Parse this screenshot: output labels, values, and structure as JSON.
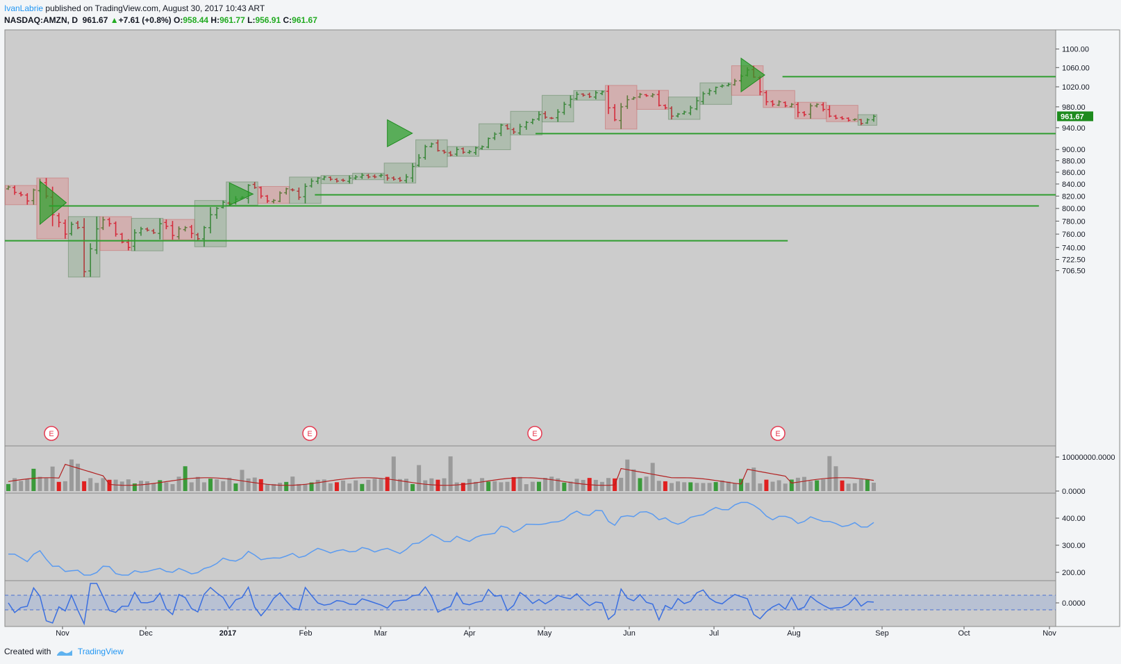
{
  "header": {
    "user": "IvanLabrie",
    "published_text": "published on TradingView.com, August 30, 2017 10:43 ART",
    "symbol": "NASDAQ:AMZN, D",
    "last": "961.67",
    "change": "+7.61 (+0.8%)",
    "o_label": "O:",
    "o_value": "958.44",
    "h_label": "H:",
    "h_value": "961.77",
    "l_label": "L:",
    "l_value": "956.91",
    "c_label": "C:",
    "c_value": "961.67"
  },
  "footer": {
    "created_with": "Created with",
    "brand": "TradingView"
  },
  "colors": {
    "up": "#1b7a1b",
    "down": "#d0021b",
    "panel_bg": "#cccccc",
    "hline": "#2f9d2f",
    "ma_line": "#b22222",
    "obv_line": "#5b9bf0",
    "badge_red": "#e53950"
  },
  "chart_data": {
    "type": "ohlc",
    "price": {
      "y_ticks": [
        1100,
        1060,
        1020,
        980,
        940,
        900,
        880,
        860,
        840,
        820,
        800,
        780,
        760,
        740,
        722.5,
        706.5
      ],
      "tick_labels": [
        "1100.00",
        "1060.00",
        "1020.00",
        "980.00",
        "940.00",
        "900.00",
        "880.00",
        "860.00",
        "840.00",
        "820.00",
        "800.00",
        "780.00",
        "760.00",
        "740.00",
        "722.50",
        "706.50"
      ],
      "last_price": 961.67,
      "last_label": "961.67",
      "closes": [
        835,
        826,
        822,
        812,
        830,
        842,
        820,
        790,
        778,
        760,
        775,
        770,
        705,
        738,
        768,
        782,
        776,
        760,
        748,
        740,
        762,
        768,
        766,
        762,
        776,
        772,
        758,
        768,
        770,
        761,
        753,
        770,
        790,
        800,
        810,
        808,
        815,
        818,
        838,
        834,
        820,
        812,
        813,
        825,
        832,
        830,
        818,
        836,
        845,
        850,
        852,
        848,
        845,
        846,
        850,
        852,
        855,
        852,
        852,
        855,
        850,
        848,
        846,
        852,
        870,
        885,
        905,
        910,
        898,
        895,
        890,
        900,
        895,
        896,
        903,
        905,
        920,
        928,
        945,
        938,
        932,
        942,
        950,
        955,
        965,
        960,
        958,
        970,
        985,
        995,
        1005,
        1003,
        1000,
        1008,
        1010,
        978,
        955,
        980,
        994,
        998,
        1005,
        1002,
        1004,
        983,
        978,
        962,
        966,
        970,
        978,
        992,
        1006,
        1012,
        1019,
        1022,
        1025,
        1032,
        1042,
        1055,
        1040,
        1010,
        990,
        985,
        990,
        982,
        985,
        969,
        965,
        982,
        985,
        975,
        962,
        958,
        957,
        954,
        956,
        948,
        955,
        961.67
      ],
      "hlines": [
        {
          "price": 1041,
          "x_start": 0.74,
          "x_end": 1.0
        },
        {
          "price": 929,
          "x_start": 0.505,
          "x_end": 1.0
        },
        {
          "price": 822,
          "x_start": 0.295,
          "x_end": 1.0
        },
        {
          "price": 804,
          "x_start": 0.042,
          "x_end": 0.984
        },
        {
          "price": 750,
          "x_start": 0.0,
          "x_end": 0.745
        }
      ],
      "earnings_badges": [
        "E",
        "E",
        "E",
        "E"
      ]
    },
    "volume": {
      "tick_labels": [
        "10000000.0000",
        "0.0000"
      ]
    },
    "obv": {
      "tick_labels": [
        "400.00",
        "300.00",
        "200.00"
      ]
    },
    "oscillator": {
      "tick_labels": [
        "0.0000"
      ]
    },
    "x_axis": {
      "labels": [
        "Nov",
        "Dec",
        "2017",
        "Feb",
        "Mar",
        "Apr",
        "May",
        "Jun",
        "Jul",
        "Aug",
        "Sep",
        "Oct",
        "Nov"
      ]
    }
  }
}
